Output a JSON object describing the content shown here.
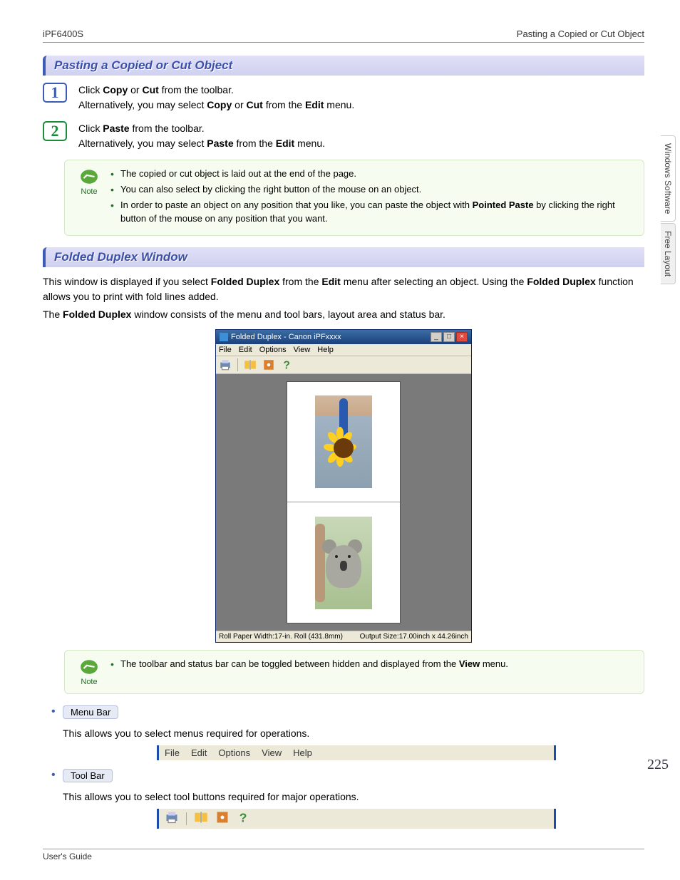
{
  "header": {
    "model": "iPF6400S",
    "breadcrumb": "Pasting a Copied or Cut Object"
  },
  "section1": {
    "title": "Pasting a Copied or Cut Object",
    "step1": {
      "line1_pre": "Click ",
      "copy": "Copy",
      "mid1": " or ",
      "cut": "Cut",
      "post1": " from the toolbar.",
      "line2_pre": "Alternatively, you may select ",
      "copy2": "Copy",
      "mid2": " or ",
      "cut2": "Cut",
      "post2": " from the ",
      "edit": "Edit",
      "post3": " menu."
    },
    "step2": {
      "line1_pre": "Click ",
      "paste": "Paste",
      "post1": " from the toolbar.",
      "line2_pre": "Alternatively, you may select ",
      "paste2": "Paste",
      "post2": " from the ",
      "edit": "Edit",
      "post3": " menu."
    },
    "note": {
      "label": "Note",
      "items": {
        "0": "The copied or cut object is laid out at the end of the page.",
        "1": "You can also select by clicking the right button of the mouse on an object.",
        "2_pre": "In order to paste an object on any position that you like, you can paste the object with ",
        "2_bold": "Pointed Paste",
        "2_post": " by clicking the right button of the mouse on any position that you want."
      }
    }
  },
  "section2": {
    "title": "Folded Duplex Window",
    "para1_pre": "This window is displayed if you select ",
    "para1_b1": "Folded Duplex",
    "para1_mid": " from the ",
    "para1_b2": "Edit",
    "para1_mid2": " menu after selecting an object. Using the ",
    "para1_b3": "Folded Duplex",
    "para1_post": " function allows you to print with fold lines added.",
    "para2_pre": "The ",
    "para2_b": "Folded Duplex",
    "para2_post": " window consists of the menu and tool bars, layout area and status bar.",
    "fd_window": {
      "title": "Folded Duplex - Canon iPFxxxx",
      "menu": {
        "file": "File",
        "edit": "Edit",
        "options": "Options",
        "view": "View",
        "help": "Help"
      },
      "status_left": "Roll Paper Width:17-in. Roll (431.8mm)",
      "status_right": "Output Size:17.00inch x 44.26inch"
    },
    "note2": {
      "label": "Note",
      "item_pre": "The toolbar and status bar can be toggled between hidden and displayed from the ",
      "item_b": "View",
      "item_post": " menu."
    },
    "menubar": {
      "label": "Menu Bar",
      "desc": "This allows you to select menus required for operations."
    },
    "menubar_fig": {
      "file": "File",
      "edit": "Edit",
      "options": "Options",
      "view": "View",
      "help": "Help"
    },
    "toolbar": {
      "label": "Tool Bar",
      "desc": "This allows you to select tool buttons required for major operations."
    }
  },
  "side": {
    "tab1": "Windows Software",
    "tab2": "Free Layout"
  },
  "page_number": "225",
  "footer": "User's Guide"
}
